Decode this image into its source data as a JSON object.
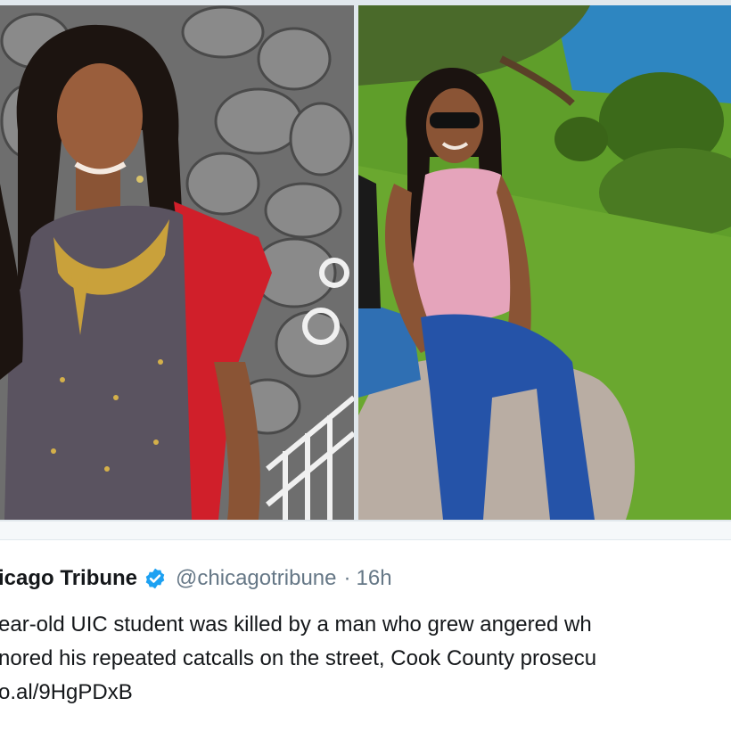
{
  "tweet": {
    "display_name": "icago Tribune",
    "handle": "@chicagotribune",
    "separator": "·",
    "time": "16h",
    "line1": "ear-old UIC student was killed by a man who grew angered wh",
    "line2": "nored his repeated catcalls on the street, Cook County prosecu",
    "link": "o.al/9HgPDxB"
  },
  "icons": {
    "verified": "verified-badge-icon"
  },
  "colors": {
    "verified_blue": "#1da1f2",
    "text_primary": "#14171a",
    "text_secondary": "#657786"
  }
}
